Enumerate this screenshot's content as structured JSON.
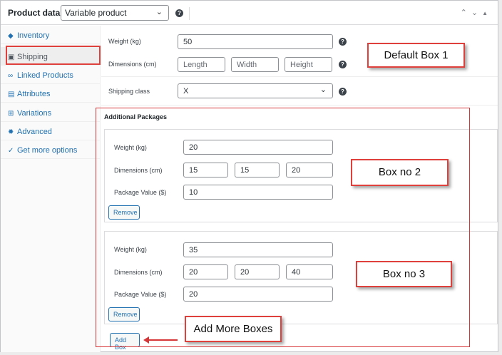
{
  "header": {
    "title": "Product data —",
    "product_type": "Variable product",
    "help": "?"
  },
  "sidebar": {
    "items": [
      {
        "label": "Inventory",
        "icon": "tag-icon",
        "active": false
      },
      {
        "label": "Shipping",
        "icon": "truck-icon",
        "active": true
      },
      {
        "label": "Linked Products",
        "icon": "link-icon",
        "active": false
      },
      {
        "label": "Attributes",
        "icon": "list-icon",
        "active": false
      },
      {
        "label": "Variations",
        "icon": "grid-icon",
        "active": false
      },
      {
        "label": "Advanced",
        "icon": "gear-icon",
        "active": false
      },
      {
        "label": "Get more options",
        "icon": "plugin-icon",
        "active": false
      }
    ]
  },
  "shipping": {
    "weight_label": "Weight (kg)",
    "weight_value": "50",
    "dimensions_label": "Dimensions (cm)",
    "length_placeholder": "Length",
    "width_placeholder": "Width",
    "height_placeholder": "Height",
    "class_label": "Shipping class",
    "class_value": "X"
  },
  "packages": {
    "title": "Additional Packages",
    "weight_label": "Weight (kg)",
    "dimensions_label": "Dimensions (cm)",
    "value_label": "Package Value ($)",
    "remove_label": "Remove",
    "add_label": "Add Box",
    "boxes": [
      {
        "weight": "20",
        "length": "15",
        "width": "15",
        "height": "20",
        "value": "10"
      },
      {
        "weight": "35",
        "length": "20",
        "width": "20",
        "height": "40",
        "value": "20"
      }
    ]
  },
  "annotations": {
    "default_box": "Default Box 1",
    "box2": "Box no 2",
    "box3": "Box no 3",
    "add_more": "Add More Boxes"
  },
  "colors": {
    "accent": "#2271b1",
    "annotation_red": "#e0403b"
  }
}
